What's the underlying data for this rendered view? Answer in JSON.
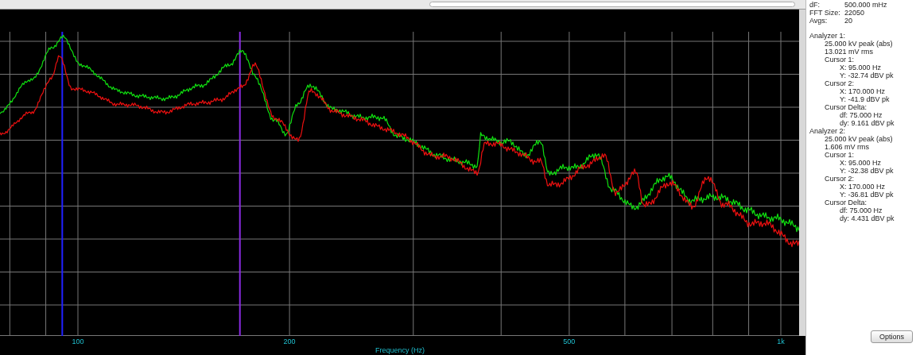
{
  "plot": {
    "x_tick_labels": [
      "100",
      "200",
      "500",
      "1k"
    ],
    "xlabel": "Frequency (Hz)"
  },
  "info": {
    "fields": [
      {
        "label": "dF:",
        "value": "500.000 mHz"
      },
      {
        "label": "FFT Size:",
        "value": "22050"
      },
      {
        "label": "Avgs:",
        "value": "20"
      }
    ],
    "analyzers": [
      {
        "text": "Analyzer 1:",
        "children": [
          {
            "text": "25.000 kV peak (abs)"
          },
          {
            "text": "13.021 mV rms"
          },
          {
            "text": "Cursor 1:",
            "children": [
              {
                "text": "X: 95.000 Hz"
              },
              {
                "text": "Y: -32.74 dBV pk"
              }
            ]
          },
          {
            "text": "Cursor 2:",
            "children": [
              {
                "text": "X: 170.000 Hz"
              },
              {
                "text": "Y: -41.9 dBV pk"
              }
            ]
          },
          {
            "text": "Cursor Delta:",
            "children": [
              {
                "text": "df: 75.000 Hz"
              },
              {
                "text": "dy: 9.161 dBV pk"
              }
            ]
          }
        ]
      },
      {
        "text": "Analyzer 2:",
        "children": [
          {
            "text": "25.000 kV peak (abs)"
          },
          {
            "text": "1.606 mV rms"
          },
          {
            "text": "Cursor 1:",
            "children": [
              {
                "text": "X: 95.000 Hz"
              },
              {
                "text": "Y: -32.38 dBV pk"
              }
            ]
          },
          {
            "text": "Cursor 2:",
            "children": [
              {
                "text": "X: 170.000 Hz"
              },
              {
                "text": "Y: -36.81 dBV pk"
              }
            ]
          },
          {
            "text": "Cursor Delta:",
            "children": [
              {
                "text": "df: 75.000 Hz"
              },
              {
                "text": "dy: 4.431 dBV pk"
              }
            ]
          }
        ]
      }
    ]
  },
  "options_button": "Options"
}
